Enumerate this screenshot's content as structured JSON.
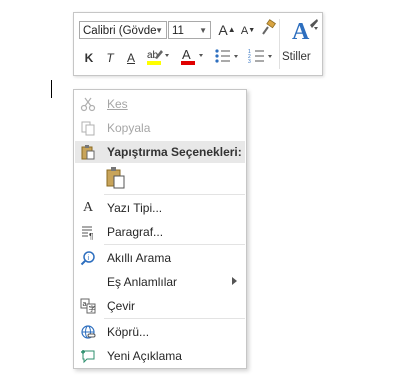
{
  "toolbar": {
    "font_name": "Calibri (Gövde",
    "font_size": "11",
    "grow_font": "A",
    "shrink_font": "A",
    "bold": "K",
    "italic": "T",
    "underline": "A",
    "styles_label": "Stiller",
    "highlight_color": "#ffff00",
    "font_color": "#e00000"
  },
  "menu": {
    "cut": "Kes",
    "copy": "Kopyala",
    "paste_header": "Yapıştırma Seçenekleri:",
    "font": "Yazı Tipi...",
    "paragraph": "Paragraf...",
    "smart_lookup": "Akıllı Arama",
    "synonyms": "Eş Anlamlılar",
    "translate": "Çevir",
    "hyperlink": "Köprü...",
    "new_comment": "Yeni Açıklama"
  }
}
